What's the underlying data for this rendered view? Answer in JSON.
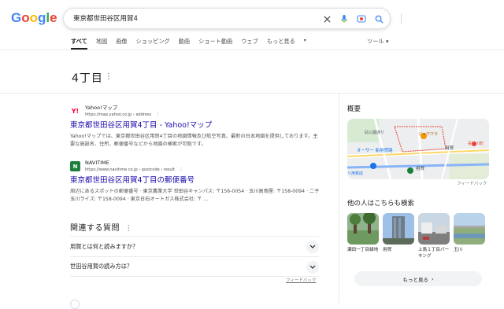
{
  "logo": {
    "text": "Google",
    "colors": [
      "#4285F4",
      "#EA4335",
      "#FBBC05",
      "#4285F4",
      "#34A853",
      "#EA4335"
    ]
  },
  "search": {
    "query": "東京都世田谷区用賀4"
  },
  "tabs": [
    {
      "label": "すべて",
      "active": true
    },
    {
      "label": "地図"
    },
    {
      "label": "画像"
    },
    {
      "label": "ショッピング"
    },
    {
      "label": "動画"
    },
    {
      "label": "ショート動画"
    },
    {
      "label": "ウェブ"
    },
    {
      "label": "もっと見る"
    }
  ],
  "tools_label": "ツール",
  "knowledge_title": "4丁目",
  "results": [
    {
      "favicon": "Y!",
      "favicon_color": "#ff0033",
      "site": "Yahoo!マップ",
      "url": "https://map.yahoo.co.jp › address",
      "title": "東京都世田谷区用賀4丁目 - Yahoo!マップ",
      "snippet": "Yahoo!マップでは、東京都世田谷区用賀4丁目の地図情報及び航空写真、最新の日本地図を提供しております。主要な施設名、住所、郵便番号などから地図の検索が可能です。"
    },
    {
      "favicon": "N",
      "favicon_color": "#1e7f3c",
      "site": "NAVITIME",
      "url": "https://www.navitime.co.jp › postcode › result",
      "title": "東京都世田谷区用賀4丁目の郵便番号",
      "snippet": "周辺にあるスポットの郵便番号 · 東京農業大学 世田谷キャンパス: 〒156-0054 · 玉川高島屋: 〒158-0094 · 二子玉川ライズ: 〒158-0094 · 東京日石オートガス株式会社: 〒 ..."
    }
  ],
  "faq": {
    "heading": "関連する質問",
    "questions": [
      "用賀とは何と読みますか？",
      "世田谷用賀の読み方は？"
    ],
    "feedback": "フィードバック"
  },
  "right_panel": {
    "overview": "概要",
    "map_feedback": "フィードバック",
    "map_labels": [
      "砧公園通り",
      "ジョウワラ",
      "オーサー 新用賀路",
      "用賀",
      "長谷川町",
      "リ用賀店",
      "用賀"
    ],
    "people_also": "他の人はこちらも検索",
    "people_items": [
      "瀬田一丁目緑地",
      "用賀",
      "上馬１丁目パーキング",
      "玉川"
    ],
    "more_button": "もっと見る"
  }
}
